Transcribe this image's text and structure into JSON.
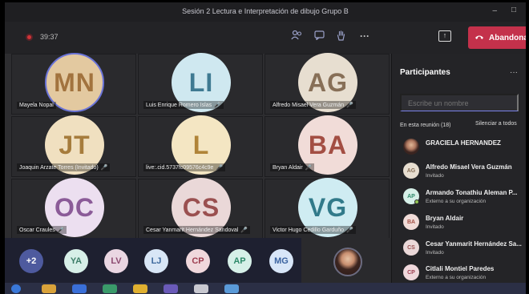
{
  "window": {
    "title": "Sesión 2 Lectura e Interpretación de dibujo Grupo B",
    "minimize": "–",
    "maximize": "□"
  },
  "toolbar": {
    "timer": "39:37",
    "share_glyph": "↑",
    "leave_label": "Abandonar",
    "more": "···"
  },
  "tiles": [
    {
      "initials": "MN",
      "name": "Mayela Nopal",
      "mic": "",
      "bg": "#e3c9a0",
      "fg": "#a2733e"
    },
    {
      "initials": "LI",
      "name": "Luis Enrique Romero Islas",
      "mic": "🎤",
      "bg": "#cfe8f0",
      "fg": "#3f7a92"
    },
    {
      "initials": "AG",
      "name": "Alfredo Misael Vera Guzmán",
      "mic": "🎤",
      "bg": "#e7ded0",
      "fg": "#876f57"
    },
    {
      "initials": "JT",
      "name": "Joaquin Arzate Torres (Invitado)",
      "mic": "🎤",
      "bg": "#f0e0c0",
      "fg": "#a67c3c"
    },
    {
      "initials": "L",
      "name": "live:.cid.5737fc09576c4c9e",
      "mic": "🎤",
      "bg": "#f4e6c3",
      "fg": "#b08438"
    },
    {
      "initials": "BA",
      "name": "Bryan Aldair",
      "mic": "🎤",
      "bg": "#f1dcd8",
      "fg": "#a34e43"
    },
    {
      "initials": "OC",
      "name": "Oscar Craules",
      "mic": "🎤",
      "bg": "#ecdff0",
      "fg": "#8b5b98"
    },
    {
      "initials": "CS",
      "name": "Cesar Yanmarit Hernández Sandoval",
      "mic": "🎤",
      "bg": "#ead8d8",
      "fg": "#9a5050"
    },
    {
      "initials": "VG",
      "name": "Victor Hugo Cedillo Garduño",
      "mic": "🎤",
      "bg": "#cfecf2",
      "fg": "#317a8a"
    }
  ],
  "mini_avatars": [
    {
      "initials": "+2",
      "bg": "#4e5a9e",
      "fg": "#ffffff"
    },
    {
      "initials": "YA",
      "bg": "#d7efe8",
      "fg": "#3e7f6a"
    },
    {
      "initials": "LV",
      "bg": "#ead6e2",
      "fg": "#8c4a70"
    },
    {
      "initials": "LJ",
      "bg": "#d8e6f6",
      "fg": "#3e6a9e"
    },
    {
      "initials": "CP",
      "bg": "#f0d8dc",
      "fg": "#9e3e50"
    },
    {
      "initials": "AP",
      "bg": "#d6f0e8",
      "fg": "#2e8a6a"
    },
    {
      "initials": "MG",
      "bg": "#d8e6f8",
      "fg": "#3a62a0"
    }
  ],
  "panel": {
    "title": "Participantes",
    "more": "···",
    "search_placeholder": "Escribe un nombre",
    "in_meeting": "En esta reunión (18)",
    "mute_all": "Silenciar a todos",
    "participants": [
      {
        "initials": "GH",
        "name": "GRACIELA HERNANDEZ",
        "sub": "",
        "bg": "#6b4a3e",
        "fg": "#ffffff"
      },
      {
        "initials": "AG",
        "name": "Alfredo Misael Vera Guzmán",
        "sub": "Invitado",
        "bg": "#e7ded0",
        "fg": "#876f57"
      },
      {
        "initials": "AP",
        "name": "Armando Tonathiu Aleman P...",
        "sub": "Externo a su organización",
        "bg": "#d6f0e8",
        "fg": "#2e8a6a"
      },
      {
        "initials": "BA",
        "name": "Bryan Aldair",
        "sub": "Invitado",
        "bg": "#f1dcd8",
        "fg": "#a34e43"
      },
      {
        "initials": "CS",
        "name": "Cesar Yanmarit Hernández Sa...",
        "sub": "Invitado",
        "bg": "#ead8d8",
        "fg": "#9a5050"
      },
      {
        "initials": "CP",
        "name": "Citlali Montiel Paredes",
        "sub": "Externo a su organización",
        "bg": "#f0d8dc",
        "fg": "#9e3e50"
      }
    ]
  },
  "colors": {
    "accent": "#7b83eb",
    "leave": "#c4314b",
    "rec": "#d13438",
    "online": "#92c353"
  }
}
